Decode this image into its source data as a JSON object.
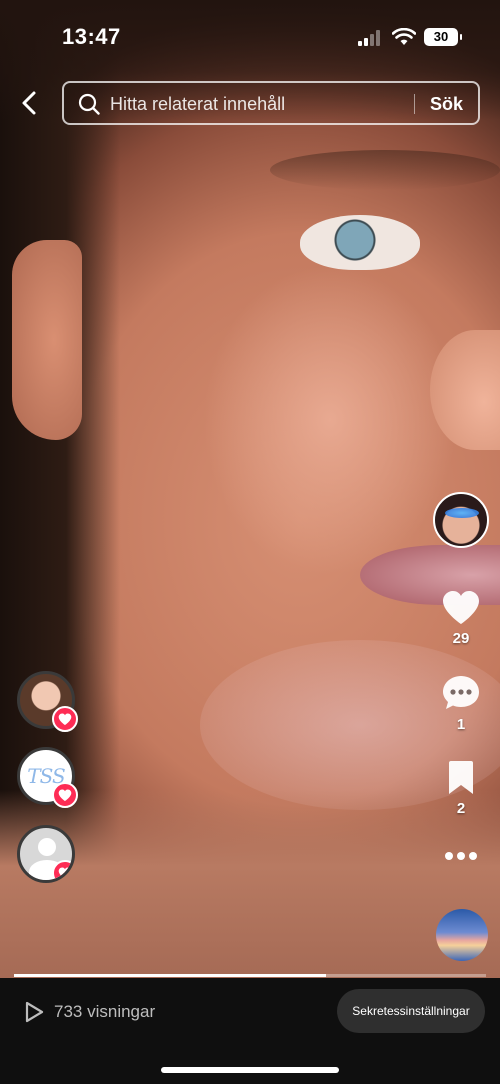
{
  "status_bar": {
    "time": "13:47",
    "battery": "30"
  },
  "header": {
    "back_icon": "chevron-left-icon",
    "search_placeholder": "Hitta relaterat innehåll",
    "search_button": "Sök"
  },
  "right_rail": {
    "likes": "29",
    "comments": "1",
    "saves": "2"
  },
  "left_rail": {
    "viewer_2_monogram": "TSS"
  },
  "bottom_bar": {
    "views": "733 visningar",
    "privacy_button": "Sekretessinställningar",
    "progress": 0.66
  },
  "colors": {
    "like_badge": "#fe2c55",
    "bottom_bar_bg": "#0f0f0f"
  }
}
